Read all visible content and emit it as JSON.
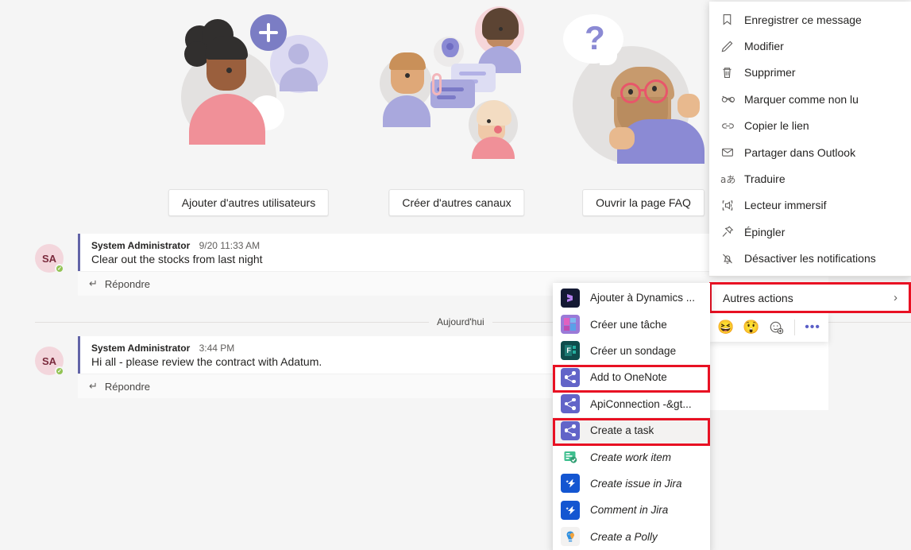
{
  "welcome": {
    "cards": [
      {
        "illustration": "add-users-illustration",
        "button": "Ajouter d'autres utilisateurs"
      },
      {
        "illustration": "channels-chat-illustration",
        "button": "Créer d'autres canaux"
      },
      {
        "illustration": "faq-question-illustration",
        "button": "Ouvrir la page FAQ"
      }
    ]
  },
  "messages": [
    {
      "avatar_initials": "SA",
      "author": "System Administrator",
      "time": "9/20 11:33 AM",
      "body": "Clear out the stocks from last night",
      "reply_label": "Répondre"
    },
    {
      "avatar_initials": "SA",
      "author": "System Administrator",
      "time": "3:44 PM",
      "body": "Hi all - please review the contract with Adatum.",
      "reply_label": "Répondre"
    }
  ],
  "day_divider": "Aujourd'hui",
  "context_menu": {
    "items": [
      {
        "icon": "bookmark-icon",
        "label": "Enregistrer ce message"
      },
      {
        "icon": "pencil-icon",
        "label": "Modifier"
      },
      {
        "icon": "trash-icon",
        "label": "Supprimer"
      },
      {
        "icon": "mark-unread-icon",
        "label": "Marquer comme non lu"
      },
      {
        "icon": "link-icon",
        "label": "Copier le lien"
      },
      {
        "icon": "envelope-icon",
        "label": "Partager dans Outlook"
      },
      {
        "icon": "translate-icon",
        "label": "Traduire"
      },
      {
        "icon": "immersive-reader-icon",
        "label": "Lecteur immersif"
      },
      {
        "icon": "pin-icon",
        "label": "Épingler"
      },
      {
        "icon": "bell-off-icon",
        "label": "Désactiver les notifications"
      }
    ],
    "more_actions": {
      "label": "Autres actions",
      "chevron": "chevron-right-icon",
      "highlighted": true
    }
  },
  "reactions": {
    "items": [
      "laugh-emoji",
      "surprised-emoji",
      "add-reaction-icon"
    ],
    "more": "more-options-icon"
  },
  "flyout": {
    "items": [
      {
        "icon": "dynamics-icon",
        "label": "Ajouter à Dynamics ...",
        "italic": false,
        "highlighted": false,
        "selected": false
      },
      {
        "icon": "planner-icon",
        "label": "Créer une tâche",
        "italic": false,
        "highlighted": false,
        "selected": false
      },
      {
        "icon": "forms-icon",
        "label": "Créer un sondage",
        "italic": false,
        "highlighted": false,
        "selected": false
      },
      {
        "icon": "flow-share-icon",
        "label": "Add to OneNote",
        "italic": false,
        "highlighted": true,
        "selected": false
      },
      {
        "icon": "flow-share-icon",
        "label": "ApiConnection -&gt...",
        "italic": false,
        "highlighted": false,
        "selected": false
      },
      {
        "icon": "flow-share-icon",
        "label": "Create a task",
        "italic": false,
        "highlighted": true,
        "selected": true
      },
      {
        "icon": "azuredevops-icon",
        "label": "Create work item",
        "italic": true,
        "highlighted": false,
        "selected": false
      },
      {
        "icon": "jira-icon",
        "label": "Create issue in Jira",
        "italic": true,
        "highlighted": false,
        "selected": false
      },
      {
        "icon": "jira-icon",
        "label": "Comment in Jira",
        "italic": true,
        "highlighted": false,
        "selected": false
      },
      {
        "icon": "polly-icon",
        "label": "Create a Polly",
        "italic": true,
        "highlighted": false,
        "selected": false
      }
    ]
  },
  "colors": {
    "accent": "#6264a7",
    "highlight": "#e81123",
    "presence_available": "#92c353",
    "avatar_bg": "#f3d6dc",
    "page_bg": "#f5f5f5"
  }
}
